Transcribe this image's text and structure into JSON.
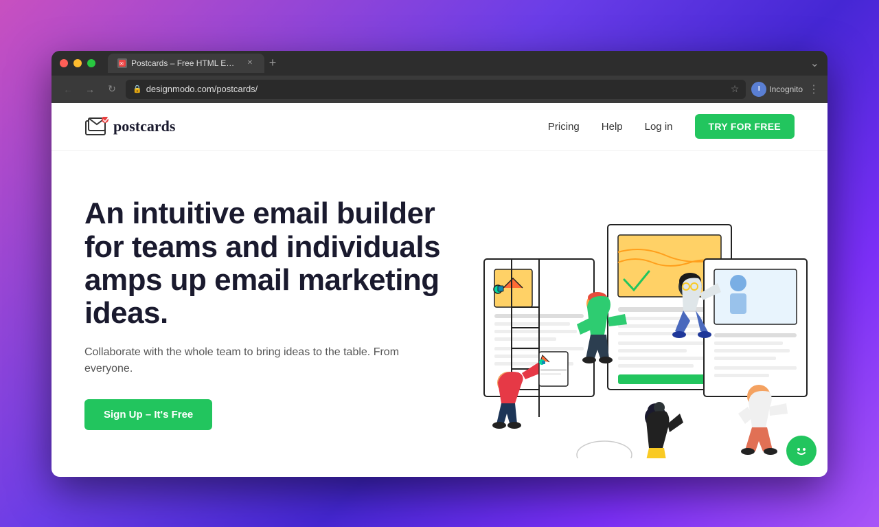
{
  "window": {
    "title": "Postcards – Free HTML Email",
    "tab_label": "Postcards – Free HTML Email T...",
    "url_display": "designmodo.com/postcards/",
    "url_protocol": "https://",
    "profile_name": "Incognito"
  },
  "nav": {
    "logo_text": "postcards",
    "links": [
      {
        "label": "Pricing",
        "id": "pricing"
      },
      {
        "label": "Help",
        "id": "help"
      },
      {
        "label": "Log in",
        "id": "login"
      }
    ],
    "cta_label": "TRY FOR FREE"
  },
  "hero": {
    "title": "An intuitive email builder for teams and individuals amps up email marketing ideas.",
    "subtitle": "Collaborate with the whole team to bring ideas to the table. From everyone.",
    "cta_label": "Sign Up – It's Free"
  }
}
